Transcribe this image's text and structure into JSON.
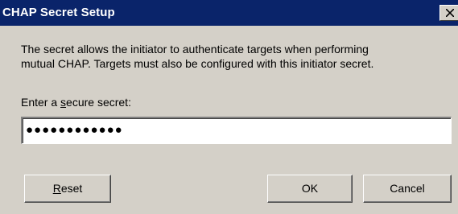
{
  "window": {
    "title": "CHAP Secret Setup",
    "close_glyph": "X"
  },
  "description": {
    "line1": "The secret allows the initiator to authenticate targets when performing",
    "line2": "mutual CHAP.  Targets must also be configured with this initiator secret."
  },
  "secret_field": {
    "label_prefix": "Enter a ",
    "label_accel": "s",
    "label_suffix": "ecure secret:",
    "masked_value": "●●●●●●●●●●●●"
  },
  "buttons": {
    "reset_accel": "R",
    "reset_rest": "eset",
    "ok_label": "OK",
    "cancel_label": "Cancel"
  },
  "colors": {
    "titlebar": "#0a246a",
    "dialog_bg": "#d4d0c8"
  }
}
